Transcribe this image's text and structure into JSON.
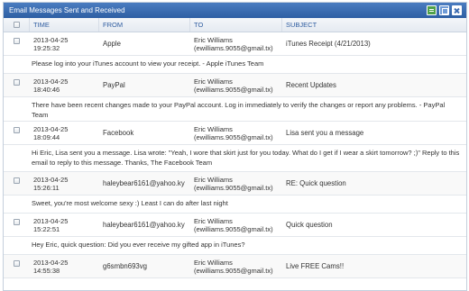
{
  "panel": {
    "title": "Email Messages Sent and Received"
  },
  "columns": {
    "time": "TIME",
    "from": "FROM",
    "to": "TO",
    "subject": "SUBJECT"
  },
  "messages": [
    {
      "date": "2013-04-25",
      "time": "19:25:32",
      "from": "Apple",
      "to_name": "Eric Williams",
      "to_email": "(ewilliams.9055@gmail.tx)",
      "subject": "iTunes Receipt (4/21/2013)",
      "body": "Please log into your iTunes account to view your receipt. - Apple iTunes Team"
    },
    {
      "date": "2013-04-25",
      "time": "18:40:46",
      "from": "PayPal",
      "to_name": "Eric Williams",
      "to_email": "(ewilliams.9055@gmail.tx)",
      "subject": "Recent Updates",
      "body": "There have been recent changes made to your PayPal account. Log in immediately to verify the changes or report any problems. - PayPal Team"
    },
    {
      "date": "2013-04-25",
      "time": "18:09:44",
      "from": "Facebook",
      "to_name": "Eric Williams",
      "to_email": "(ewilliams.9055@gmail.tx)",
      "subject": "Lisa sent you a message",
      "body": "Hi Eric, Lisa sent you a message. Lisa wrote: \"Yeah, I wore that skirt just for you today. What do I get if I wear a skirt tomorrow? ;)\" Reply to this email to reply to this message. Thanks, The Facebook Team"
    },
    {
      "date": "2013-04-25",
      "time": "15:26:11",
      "from": "haleybear6161@yahoo.ky",
      "to_name": "Eric Williams",
      "to_email": "(ewilliams.9055@gmail.tx)",
      "subject": "RE: Quick question",
      "body": "Sweet, you're most welcome sexy :) Least I can do after last night"
    },
    {
      "date": "2013-04-25",
      "time": "15:22:51",
      "from": "haleybear6161@yahoo.ky",
      "to_name": "Eric Williams",
      "to_email": "(ewilliams.9055@gmail.tx)",
      "subject": "Quick question",
      "body": "Hey Eric, quick question: Did you ever receive my gifted app in iTunes?"
    },
    {
      "date": "2013-04-25",
      "time": "14:55:38",
      "from": "g6smbn693vg",
      "to_name": "Eric Williams",
      "to_email": "(ewilliams.9055@gmail.tx)",
      "subject": "Live FREE Cams!!",
      "body": ""
    }
  ]
}
